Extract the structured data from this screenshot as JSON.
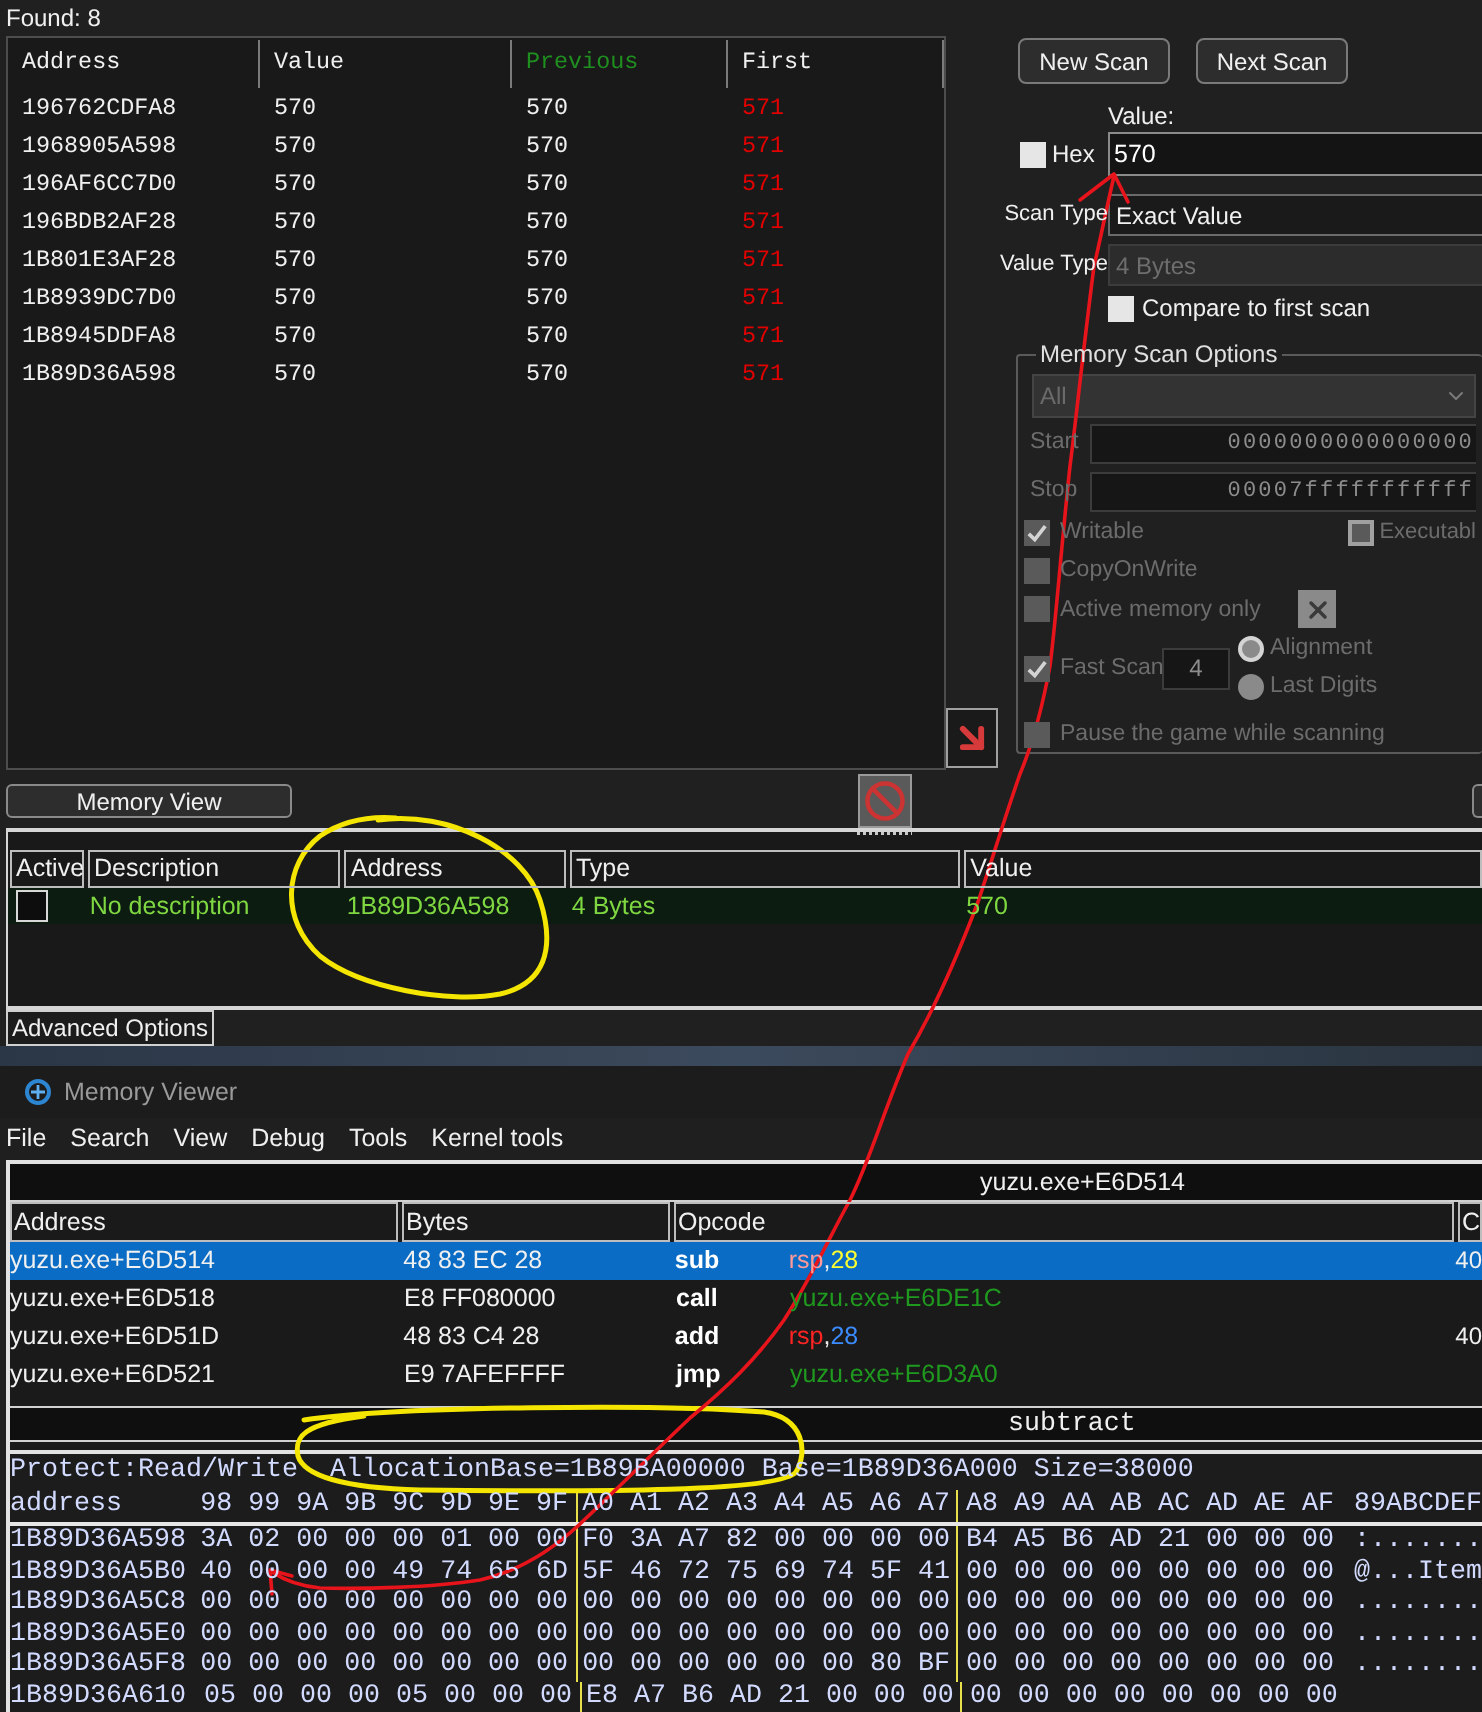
{
  "scan_results": {
    "found": "Found: 8",
    "columns": [
      {
        "label": "Address",
        "active": false
      },
      {
        "label": "Value",
        "active": false
      },
      {
        "label": "Previous",
        "active": true
      },
      {
        "label": "First",
        "active": false
      }
    ],
    "rows": [
      {
        "address": "196762CDFA8",
        "value": "570",
        "previous": "570",
        "first": "571",
        "changed": true
      },
      {
        "address": "1968905A598",
        "value": "570",
        "previous": "570",
        "first": "571",
        "changed": true
      },
      {
        "address": "196AF6CC7D0",
        "value": "570",
        "previous": "570",
        "first": "571",
        "changed": true
      },
      {
        "address": "196BDB2AF28",
        "value": "570",
        "previous": "570",
        "first": "571",
        "changed": true
      },
      {
        "address": "1B801E3AF28",
        "value": "570",
        "previous": "570",
        "first": "571",
        "changed": true
      },
      {
        "address": "1B8939DC7D0",
        "value": "570",
        "previous": "570",
        "first": "571",
        "changed": true
      },
      {
        "address": "1B8945DDFA8",
        "value": "570",
        "previous": "570",
        "first": "571",
        "changed": true
      },
      {
        "address": "1B89D36A598",
        "value": "570",
        "previous": "570",
        "first": "571",
        "changed": true
      }
    ]
  },
  "scan_controls": {
    "buttons": [
      {
        "label": "New Scan"
      },
      {
        "label": "Next Scan"
      }
    ],
    "value_label": "Value:",
    "hex": {
      "label": "Hex",
      "checked": false
    },
    "value": "570",
    "scan_type": {
      "label": "Scan Type",
      "value": "Exact Value",
      "disabled": false
    },
    "value_type": {
      "label": "Value Type",
      "value": "4 Bytes",
      "disabled": true
    },
    "compare_first": {
      "label": "Compare to first scan",
      "checked": false
    }
  },
  "memory_scan_options": {
    "title": "Memory Scan Options",
    "disabled": true,
    "region": "All",
    "start": {
      "label": "Start",
      "value": "0000000000000000"
    },
    "stop": {
      "label": "Stop",
      "value": "00007fffffffffff"
    },
    "writable": {
      "label": "Writable",
      "checked": true
    },
    "executable": {
      "label": "Executabl",
      "checked": false,
      "indeterminate": true
    },
    "copy_on_write": {
      "label": "CopyOnWrite",
      "checked": false
    },
    "active_memory_only": {
      "label": "Active memory only",
      "checked": false
    },
    "fast_scan": {
      "label": "Fast Scan",
      "checked": true,
      "value": "4"
    },
    "alignment_modes": [
      {
        "label": "Alignment",
        "selected": true
      },
      {
        "label": "Last Digits",
        "selected": false
      }
    ],
    "pause_game": {
      "label": "Pause the game while scanning",
      "checked": false
    }
  },
  "memory_view_button": "Memory View",
  "address_list": {
    "columns": [
      "Active",
      "Description",
      "Address",
      "Type",
      "Value"
    ],
    "rows": [
      {
        "active": false,
        "selected": true,
        "description": "No description",
        "address": "1B89D36A598",
        "type": "4 Bytes",
        "value": "570"
      }
    ]
  },
  "advanced_options_button": "Advanced Options",
  "memory_viewer": {
    "title": "Memory Viewer",
    "menu": [
      "File",
      "Search",
      "View",
      "Debug",
      "Tools",
      "Kernel tools"
    ],
    "disassembler": {
      "location": "yuzu.exe+E6D514",
      "columns": [
        "Address",
        "Bytes",
        "Opcode",
        "C"
      ],
      "rows": [
        {
          "address": "yuzu.exe+E6D514",
          "bytes": "48 83 EC 28",
          "mnemonic": "sub",
          "operands": [
            {
              "kind": "register",
              "text": "rsp"
            },
            {
              "kind": "punct",
              "text": ","
            },
            {
              "kind": "number",
              "text": "28"
            }
          ],
          "comment": "40",
          "selected": true
        },
        {
          "address": "yuzu.exe+E6D518",
          "bytes": "E8 FF080000",
          "mnemonic": "call",
          "operands": [
            {
              "kind": "address",
              "text": "yuzu.exe+E6DE1C"
            }
          ],
          "selected": false
        },
        {
          "address": "yuzu.exe+E6D51D",
          "bytes": "48 83 C4 28",
          "mnemonic": "add",
          "operands": [
            {
              "kind": "register",
              "text": "rsp"
            },
            {
              "kind": "punct",
              "text": ","
            },
            {
              "kind": "number",
              "text": "28"
            }
          ],
          "comment": "40",
          "selected": false
        },
        {
          "address": "yuzu.exe+E6D521",
          "bytes": "E9 7AFEFFFF",
          "mnemonic": "jmp",
          "operands": [
            {
              "kind": "address",
              "text": "yuzu.exe+E6D3A0"
            }
          ],
          "selected": false
        }
      ],
      "description": "subtract"
    },
    "hex_view": {
      "info": "Protect:Read/Write  AllocationBase=1B89BA00000 Base=1B89D36A000 Size=38000",
      "header": {
        "label": "address",
        "groups": [
          "98 99 9A 9B 9C 9D 9E 9F",
          "A0 A1 A2 A3 A4 A5 A6 A7",
          "A8 A9 AA AB AC AD AE AF"
        ],
        "ascii": "89ABCDEF"
      },
      "rows": [
        {
          "address": "1B89D36A598",
          "groups": [
            "3A 02 00 00 00 01 00 00",
            "F0 3A A7 82 00 00 00 00",
            "B4 A5 B6 AD 21 00 00 00"
          ],
          "ascii": ":......."
        },
        {
          "address": "1B89D36A5B0",
          "groups": [
            "40 00 00 00 49 74 65 6D",
            "5F 46 72 75 69 74 5F 41",
            "00 00 00 00 00 00 00 00"
          ],
          "ascii": "@...Item"
        },
        {
          "address": "1B89D36A5C8",
          "groups": [
            "00 00 00 00 00 00 00 00",
            "00 00 00 00 00 00 00 00",
            "00 00 00 00 00 00 00 00"
          ],
          "ascii": "........"
        },
        {
          "address": "1B89D36A5E0",
          "groups": [
            "00 00 00 00 00 00 00 00",
            "00 00 00 00 00 00 00 00",
            "00 00 00 00 00 00 00 00"
          ],
          "ascii": "........"
        },
        {
          "address": "1B89D36A5F8",
          "groups": [
            "00 00 00 00 00 00 00 00",
            "00 00 00 00 00 00 80 BF",
            "00 00 00 00 00 00 00 00"
          ],
          "ascii": "........"
        },
        {
          "address": "1B89D36A610",
          "groups": [
            "05 00 00 00 05 00 00 00",
            "E8 A7 B6 AD 21 00 00 00",
            "00 00 00 00 00 00 00 00"
          ]
        }
      ]
    }
  }
}
